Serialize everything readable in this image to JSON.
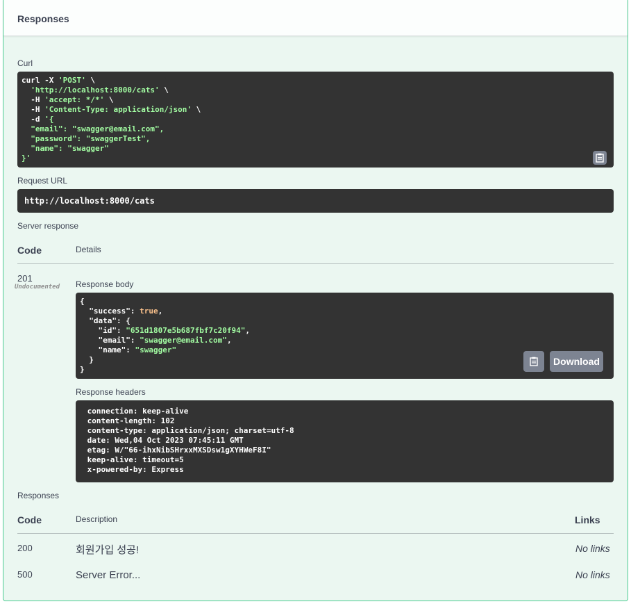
{
  "header": {
    "title": "Responses"
  },
  "curl": {
    "label": "Curl",
    "lines": [
      {
        "a": "curl -X ",
        "b": "'POST'",
        "c": " \\"
      },
      {
        "a": "  ",
        "b": "'http://localhost:8000/cats'",
        "c": " \\"
      },
      {
        "a": "  -H ",
        "b": "'accept: */*'",
        "c": " \\"
      },
      {
        "a": "  -H ",
        "b": "'Content-Type: application/json'",
        "c": " \\"
      },
      {
        "a": "  -d ",
        "b": "'{",
        "c": ""
      },
      {
        "a": "",
        "b": "  \"email\": \"swagger@email.com\",",
        "c": ""
      },
      {
        "a": "",
        "b": "  \"password\": \"swaggerTest\",",
        "c": ""
      },
      {
        "a": "",
        "b": "  \"name\": \"swagger\"",
        "c": ""
      },
      {
        "a": "",
        "b": "}'",
        "c": ""
      }
    ]
  },
  "request_url": {
    "label": "Request URL",
    "value": "http://localhost:8000/cats"
  },
  "server_response": {
    "label": "Server response",
    "col_code": "Code",
    "col_details": "Details",
    "code": "201",
    "undocumented": "Undocumented",
    "body_label": "Response body",
    "body_lines": [
      {
        "k": "{",
        "v": "",
        "t": ""
      },
      {
        "k": "  \"success\": ",
        "v": "true",
        "t": ","
      },
      {
        "k": "  \"data\": {",
        "v": "",
        "t": ""
      },
      {
        "k": "    \"id\": ",
        "s": "\"651d1807e5b687fbf7c20f94\"",
        "t": ","
      },
      {
        "k": "    \"email\": ",
        "s": "\"swagger@email.com\"",
        "t": ","
      },
      {
        "k": "    \"name\": ",
        "s": "\"swagger\"",
        "t": ""
      },
      {
        "k": "  }",
        "v": "",
        "t": ""
      },
      {
        "k": "}",
        "v": "",
        "t": ""
      }
    ],
    "download_label": "Download",
    "headers_label": "Response headers",
    "headers": " connection: keep-alive \n content-length: 102 \n content-type: application/json; charset=utf-8 \n date: Wed,04 Oct 2023 07:45:11 GMT \n etag: W/\"66-ihxNibSHrxxMXSDsw1gXYHWeF8I\" \n keep-alive: timeout=5 \n x-powered-by: Express "
  },
  "responses": {
    "label": "Responses",
    "col_code": "Code",
    "col_description": "Description",
    "col_links": "Links",
    "rows": [
      {
        "code": "200",
        "description": "회원가입 성공!",
        "links": "No links"
      },
      {
        "code": "500",
        "description": "Server Error...",
        "links": "No links"
      }
    ]
  },
  "colors": {
    "accent": "#49cc90",
    "panel_bg": "#ebf7f1",
    "code_bg": "#333333",
    "string": "#a2fca2",
    "keyword": "#fcc28c"
  },
  "icons": {
    "copy": "clipboard-icon"
  }
}
